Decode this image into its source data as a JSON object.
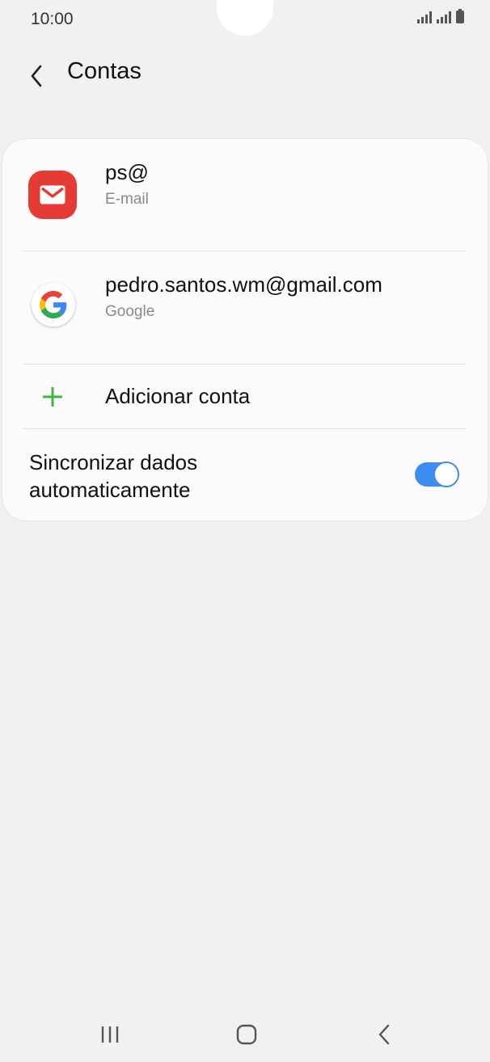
{
  "status_bar": {
    "time": "10:00"
  },
  "header": {
    "title": "Contas",
    "back_icon": "chevron-left-icon"
  },
  "accounts": [
    {
      "name": "ps@",
      "type": "E-mail",
      "icon": "email-app-icon",
      "icon_color": "#e53a35"
    },
    {
      "name": "pedro.santos.wm@gmail.com",
      "type": "Google",
      "icon": "google-icon"
    }
  ],
  "add_account": {
    "label": "Adicionar conta",
    "icon": "plus-icon",
    "icon_color": "#3fb54a"
  },
  "sync": {
    "label_line1": "Sincronizar dados",
    "label_line2": "automaticamente",
    "enabled": true,
    "toggle_color": "#3e8cf0"
  },
  "nav": {
    "recents": "recents-icon",
    "home": "home-icon",
    "back": "back-icon"
  }
}
